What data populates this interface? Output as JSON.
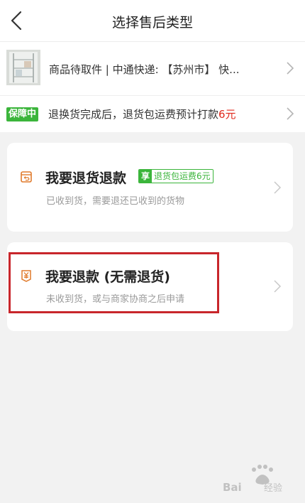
{
  "header": {
    "title": "选择售后类型",
    "back_icon": "chevron-left-icon"
  },
  "order": {
    "summary": "商品待取件 | 中通快递: 【苏州市】 快...",
    "chevron_icon": "chevron-right-icon"
  },
  "guarantee": {
    "badge": "保障中",
    "text": "退换货完成后，退货包运费预计打款",
    "amount": "6元",
    "chevron_icon": "chevron-right-icon"
  },
  "options": [
    {
      "icon": "return-box-icon",
      "title": "我要退货退款",
      "promo_prefix": "享",
      "promo_text": "退货包运费6元",
      "subtitle": "已收到货，需要退还已收到的货物"
    },
    {
      "icon": "yuan-receipt-icon",
      "title": "我要退款 (无需退货)",
      "subtitle": "未收到货，或与商家协商之后申请"
    }
  ],
  "watermark": {
    "text": "Baidu经验"
  },
  "colors": {
    "green": "#3bb53b",
    "red_amount": "#e0291c",
    "icon_orange": "#e07a2b",
    "highlight_red": "#c8262b"
  }
}
